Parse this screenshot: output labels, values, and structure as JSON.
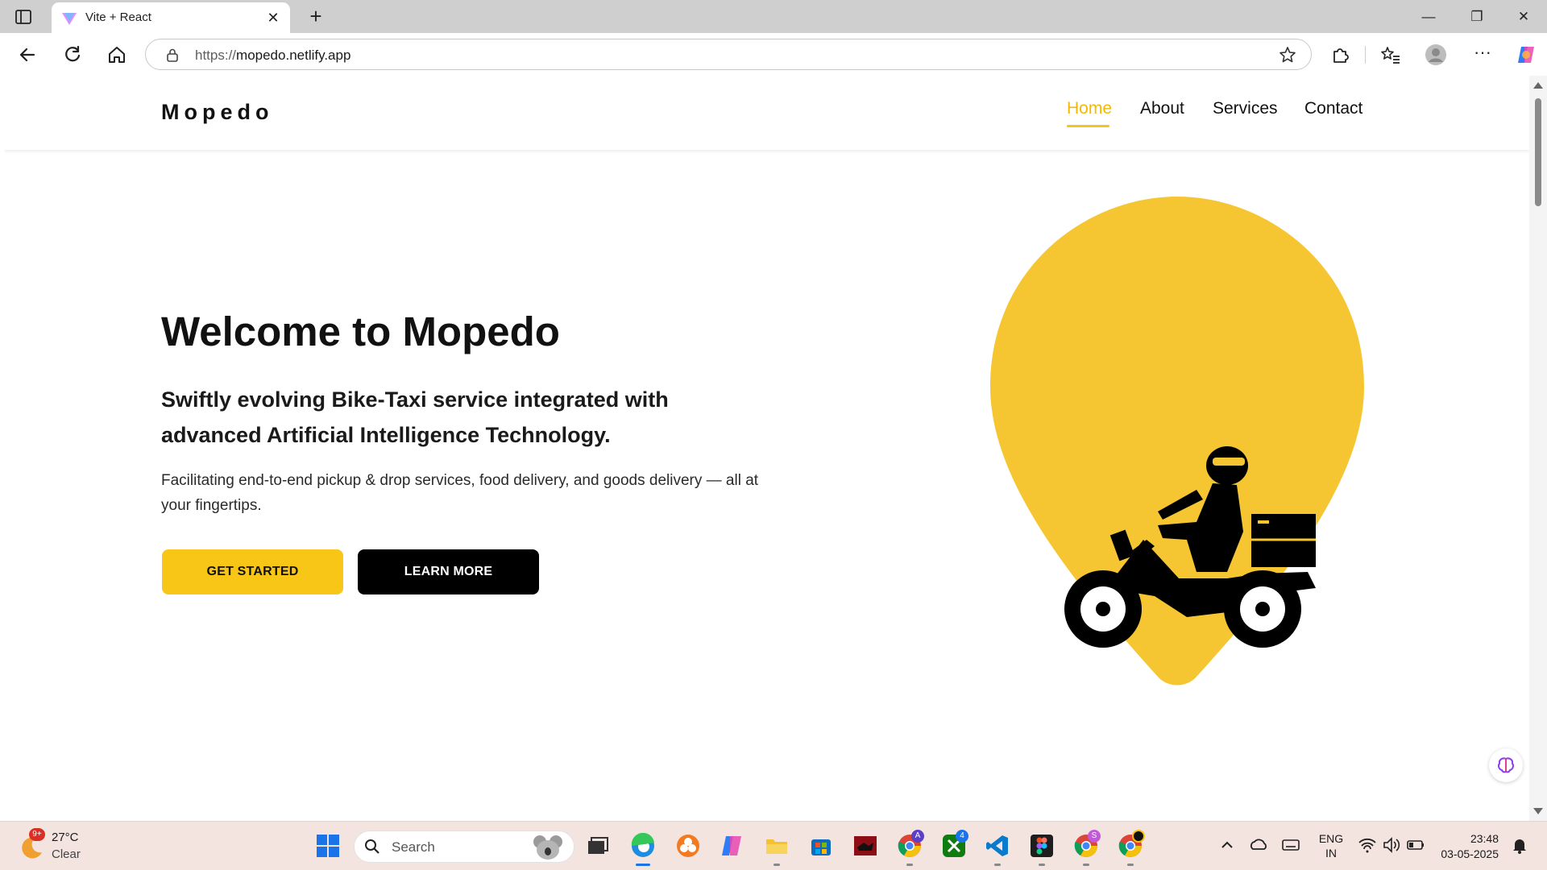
{
  "browser": {
    "tab_title": "Vite + React",
    "url_prefix": "https://",
    "url_host": "mopedo.netlify.app"
  },
  "site": {
    "logo": "Mopedo",
    "nav": [
      {
        "label": "Home",
        "active": true
      },
      {
        "label": "About",
        "active": false
      },
      {
        "label": "Services",
        "active": false
      },
      {
        "label": "Contact",
        "active": false
      }
    ],
    "hero": {
      "title": "Welcome to Mopedo",
      "subtitle": "Swiftly evolving Bike-Taxi service integrated with advanced Artificial Intelligence Technology.",
      "description": "Facilitating end-to-end pickup & drop services, food delivery, and goods delivery — all at your fingertips.",
      "primary_button": "GET STARTED",
      "secondary_button": "LEARN MORE"
    },
    "colors": {
      "accent": "#f8c617",
      "text": "#111111",
      "button_dark": "#000000"
    }
  },
  "taskbar": {
    "weather_badge": "9+",
    "weather_temp": "27°C",
    "weather_condition": "Clear",
    "search_placeholder": "Search",
    "lang_line1": "ENG",
    "lang_line2": "IN",
    "time": "23:48",
    "date": "03-05-2025",
    "badges": {
      "chrome_a": "A",
      "xbox": "4",
      "chrome_s": "S"
    },
    "apps": [
      "windows-start-icon",
      "task-view-icon",
      "edge-icon",
      "office-icon",
      "copilot-icon",
      "file-explorer-icon",
      "store-icon",
      "app-red-icon",
      "chrome-icon",
      "xbox-icon",
      "vscode-icon",
      "figma-icon",
      "chrome-profile-icon",
      "chrome-dev-icon"
    ]
  }
}
